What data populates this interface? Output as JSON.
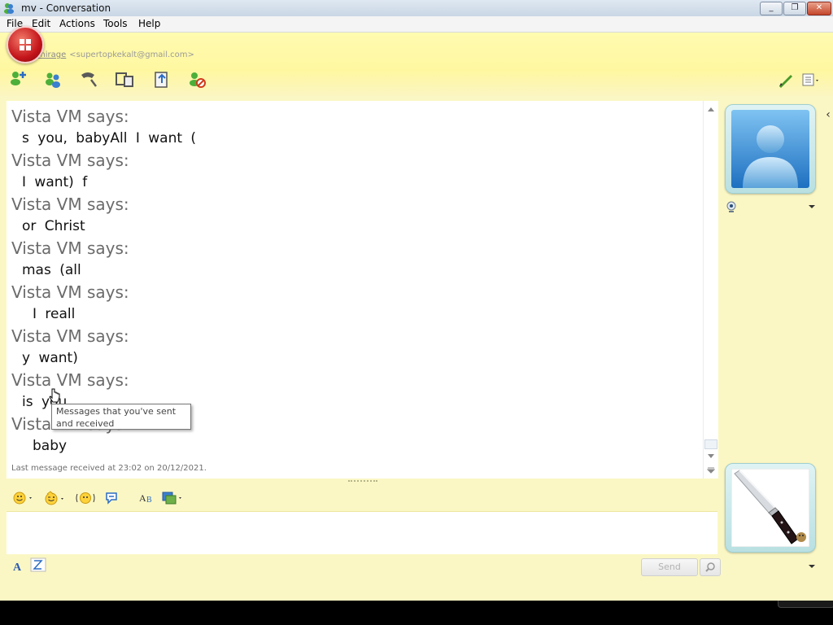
{
  "window": {
    "title": "mv - Conversation"
  },
  "menu": {
    "items": [
      "File",
      "Edit",
      "Actions",
      "Tools",
      "Help"
    ]
  },
  "contact": {
    "name": "mirage",
    "email": "<supertopkekalt@gmail.com>"
  },
  "toolbar": {
    "icons": [
      "invite-contact-icon",
      "share-contacts-icon",
      "call-icon",
      "video-call-icon",
      "send-file-icon",
      "block-contact-icon"
    ],
    "right_icons": [
      "pen-icon",
      "menu-icon"
    ]
  },
  "chat": {
    "messages": [
      {
        "sender": "Vista VM says:",
        "text": "s you, babyAll I want ("
      },
      {
        "sender": "Vista VM says:",
        "text": "I want) f"
      },
      {
        "sender": "Vista VM says:",
        "text": "or Christ"
      },
      {
        "sender": "Vista VM says:",
        "text": "mas (all"
      },
      {
        "sender": "Vista VM says:",
        "text": "  I reall"
      },
      {
        "sender": "Vista VM says:",
        "text": "y want)"
      },
      {
        "sender": "Vista VM says:",
        "text": "is you"
      },
      {
        "sender": "Vista VM says:",
        "text": "  baby"
      }
    ],
    "status": "Last message received at 23:02 on 20/12/2021.",
    "tooltip": "Messages that you've sent and received"
  },
  "compose": {
    "toolbar": [
      "emoticon-icon",
      "wink-icon",
      "nudge-icon",
      "voice-clip-icon",
      "font-icon",
      "background-icon"
    ],
    "format_icons": [
      "text-font-icon",
      "handwriting-icon"
    ],
    "send_label": "Send"
  },
  "colors": {
    "background": "#fbf7c4",
    "header": "#fff7a0",
    "accent_red": "#c4141a"
  }
}
